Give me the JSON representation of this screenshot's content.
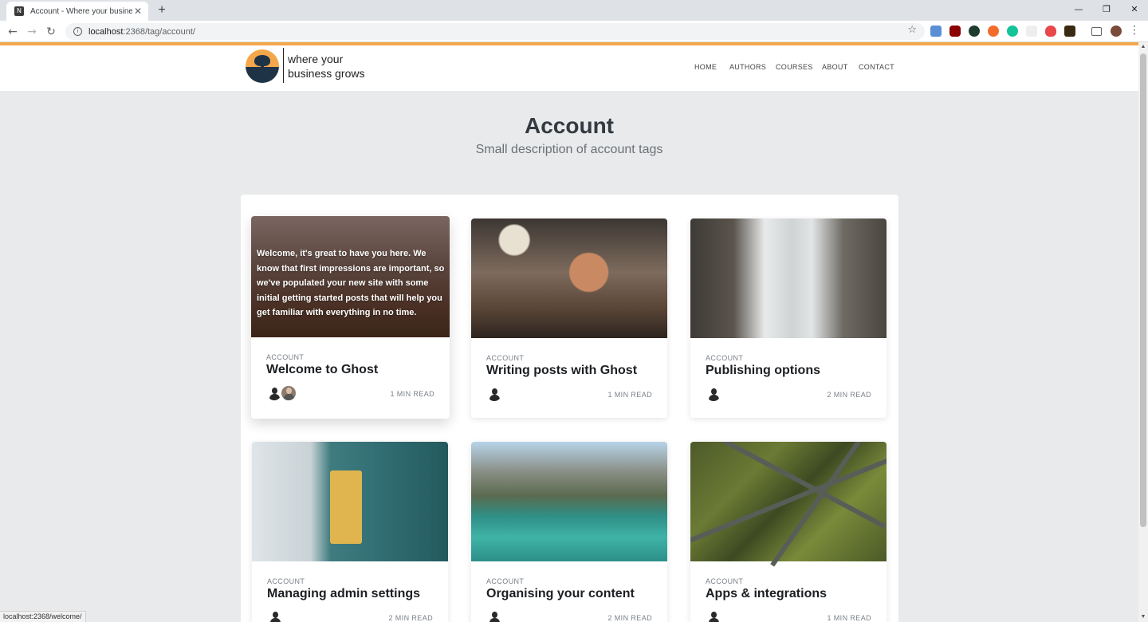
{
  "browser": {
    "tab_title": "Account - Where your business g",
    "favicon_glyph": "N",
    "url_host": "localhost",
    "url_path": ":2368/tag/account/",
    "status_url": "localhost:2368/welcome/"
  },
  "site": {
    "logo_line1": "where your",
    "logo_line2": "business grows",
    "nav": [
      "HOME",
      "AUTHORS",
      "COURSES",
      "ABOUT",
      "CONTACT"
    ],
    "accent_color": "#f4a74a"
  },
  "hero": {
    "title": "Account",
    "description": "Small description of account tags"
  },
  "posts": [
    {
      "tag": "ACCOUNT",
      "title": "Welcome to Ghost",
      "read_time": "1 MIN READ",
      "excerpt": "Welcome, it's great to have you here. We know that first impressions are important, so we've populated your new site with some initial getting started posts that will help you get familiar with everything in no time.",
      "authors": 2
    },
    {
      "tag": "ACCOUNT",
      "title": "Writing posts with Ghost",
      "read_time": "1 MIN READ",
      "authors": 1
    },
    {
      "tag": "ACCOUNT",
      "title": "Publishing options",
      "read_time": "2 MIN READ",
      "authors": 1
    },
    {
      "tag": "ACCOUNT",
      "title": "Managing admin settings",
      "read_time": "2 MIN READ",
      "authors": 1
    },
    {
      "tag": "ACCOUNT",
      "title": "Organising your content",
      "read_time": "2 MIN READ",
      "authors": 1
    },
    {
      "tag": "ACCOUNT",
      "title": "Apps & integrations",
      "read_time": "1 MIN READ",
      "authors": 1
    }
  ]
}
